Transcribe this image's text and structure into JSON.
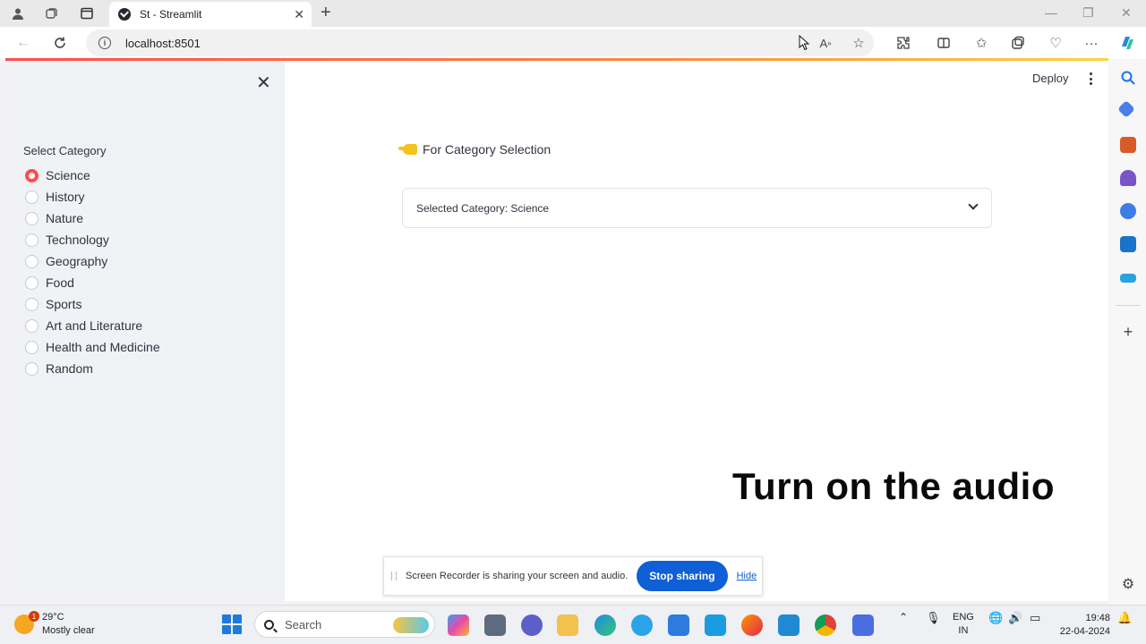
{
  "browser": {
    "tab_title": "St - Streamlit",
    "url": "localhost:8501"
  },
  "sidebar": {
    "label": "Select Category",
    "options": [
      {
        "label": "Science",
        "checked": true
      },
      {
        "label": "History",
        "checked": false
      },
      {
        "label": "Nature",
        "checked": false
      },
      {
        "label": "Technology",
        "checked": false
      },
      {
        "label": "Geography",
        "checked": false
      },
      {
        "label": "Food",
        "checked": false
      },
      {
        "label": "Sports",
        "checked": false
      },
      {
        "label": "Art and Literature",
        "checked": false
      },
      {
        "label": "Health and Medicine",
        "checked": false
      },
      {
        "label": "Random",
        "checked": false
      }
    ]
  },
  "header": {
    "deploy_label": "Deploy"
  },
  "main": {
    "section_title": "For Category Selection",
    "selectbox_value": "Selected Category: Science",
    "overlay_text": "Turn on the audio"
  },
  "recorder": {
    "message": "Screen Recorder is sharing your screen and audio.",
    "stop_label": "Stop sharing",
    "hide_label": "Hide"
  },
  "taskbar": {
    "temperature": "29°C",
    "weather": "Mostly clear",
    "weather_badge": "1",
    "search_placeholder": "Search",
    "lang_line1": "ENG",
    "lang_line2": "IN",
    "time": "19:48",
    "date": "22-04-2024"
  },
  "colors": {
    "accent": "#ff4b4b",
    "sidebar_bg": "#f0f2f6",
    "stop_button": "#0f5fd6"
  }
}
